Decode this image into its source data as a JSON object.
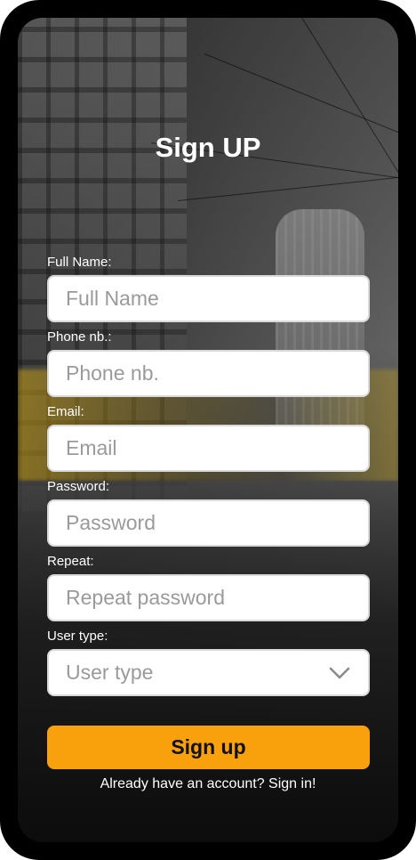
{
  "form": {
    "title": "Sign UP",
    "fields": [
      {
        "label": "Full Name:",
        "placeholder": "Full Name",
        "value": ""
      },
      {
        "label": "Phone nb.:",
        "placeholder": "Phone nb.",
        "value": ""
      },
      {
        "label": "Email:",
        "placeholder": "Email",
        "value": ""
      },
      {
        "label": "Password:",
        "placeholder": "Password",
        "value": ""
      },
      {
        "label": "Repeat:",
        "placeholder": "Repeat password",
        "value": ""
      }
    ],
    "user_type": {
      "label": "User type:",
      "selected": "User type",
      "icon": "chevron-down-icon"
    },
    "submit_label": "Sign up",
    "signin_prompt": "Already have an account?",
    "signin_link": "Sign in!"
  },
  "colors": {
    "accent": "#f9a10c",
    "input_border": "#d9d9d9",
    "placeholder": "#9a9a9a",
    "frame": "#000000"
  }
}
